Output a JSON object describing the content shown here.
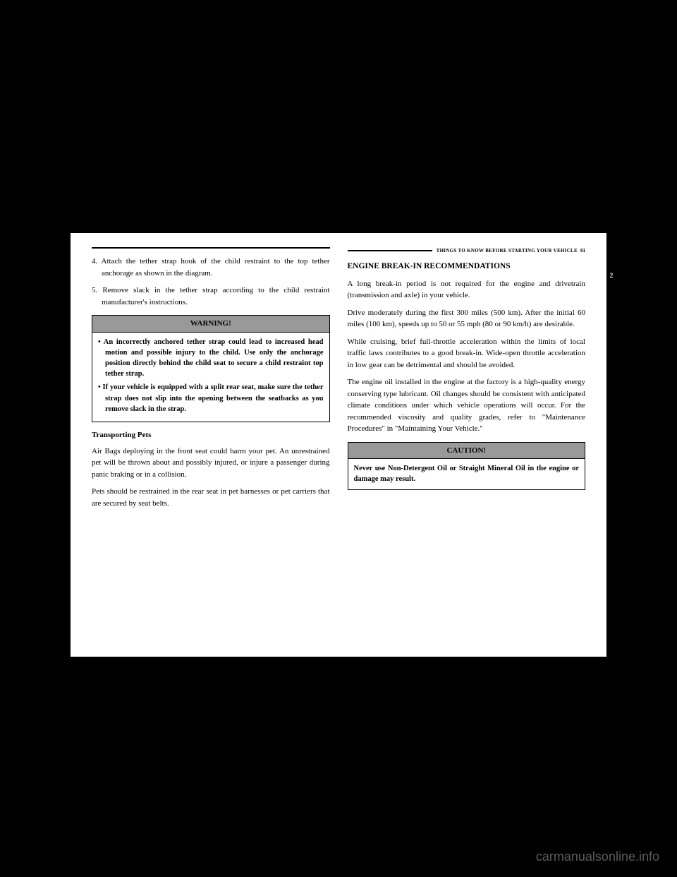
{
  "header": {
    "section_title": "THINGS TO KNOW BEFORE STARTING YOUR VEHICLE",
    "page_number": "81",
    "tab_number": "2"
  },
  "left_column": {
    "list_items": [
      "4. Attach the tether strap hook of the child restraint to the top tether anchorage as shown in the diagram.",
      "5. Remove slack in the tether strap according to the child restraint manufacturer's instructions."
    ],
    "warning": {
      "title": "WARNING!",
      "items": [
        "• An incorrectly anchored tether strap could lead to increased head motion and possible injury to the child. Use only the anchorage position directly behind the child seat to secure a child restraint top tether strap.",
        "• If your vehicle is equipped with a split rear seat, make sure the tether strap does not slip into the opening between the seatbacks as you remove slack in the strap."
      ]
    },
    "subheading": "Transporting Pets",
    "paragraphs": [
      "Air Bags deploying in the front seat could harm your pet. An unrestrained pet will be thrown about and possibly injured, or injure a passenger during panic braking or in a collision.",
      "Pets should be restrained in the rear seat in pet harnesses or pet carriers that are secured by seat belts."
    ]
  },
  "right_column": {
    "section_heading": "ENGINE BREAK-IN RECOMMENDATIONS",
    "paragraphs": [
      "A long break-in period is not required for the engine and drivetrain (transmission and axle) in your vehicle.",
      "Drive moderately during the first 300 miles (500 km). After the initial 60 miles (100 km), speeds up to 50 or 55 mph (80 or 90 km/h) are desirable.",
      "While cruising, brief full-throttle acceleration within the limits of local traffic laws contributes to a good break-in. Wide-open throttle acceleration in low gear can be detrimental and should be avoided.",
      "The engine oil installed in the engine at the factory is a high-quality energy conserving type lubricant. Oil changes should be consistent with anticipated climate conditions under which vehicle operations will occur. For the recommended viscosity and quality grades, refer to \"Maintenance Procedures\" in \"Maintaining Your Vehicle.\""
    ],
    "caution": {
      "title": "CAUTION!",
      "body": "Never use Non-Detergent Oil or Straight Mineral Oil in the engine or damage may result."
    }
  },
  "watermark": "carmanualsonline.info"
}
